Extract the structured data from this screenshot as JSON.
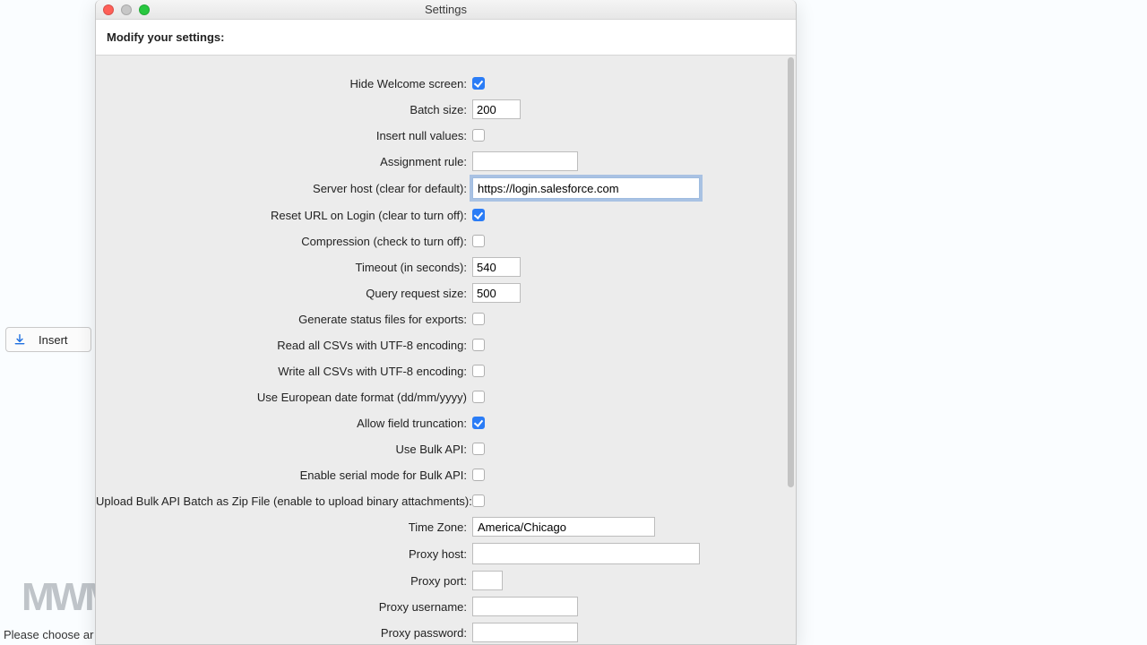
{
  "window": {
    "title": "Settings"
  },
  "header": {
    "title": "Modify your settings:"
  },
  "bg": {
    "insert_label": "Insert",
    "watermark": "MWM",
    "status": "Please choose ar"
  },
  "form": {
    "hide_welcome": {
      "label": "Hide Welcome screen:",
      "checked": true
    },
    "batch_size": {
      "label": "Batch size:",
      "value": "200"
    },
    "insert_nulls": {
      "label": "Insert null values:",
      "checked": false
    },
    "assignment_rule": {
      "label": "Assignment rule:",
      "value": ""
    },
    "server_host": {
      "label": "Server host (clear for default):",
      "value": "https://login.salesforce.com"
    },
    "reset_url": {
      "label": "Reset URL on Login (clear to turn off):",
      "checked": true
    },
    "compression": {
      "label": "Compression (check to turn off):",
      "checked": false
    },
    "timeout": {
      "label": "Timeout (in seconds):",
      "value": "540"
    },
    "query_request_size": {
      "label": "Query request size:",
      "value": "500"
    },
    "gen_status_files": {
      "label": "Generate status files for exports:",
      "checked": false
    },
    "read_utf8": {
      "label": "Read all CSVs with UTF-8 encoding:",
      "checked": false
    },
    "write_utf8": {
      "label": "Write all CSVs with UTF-8 encoding:",
      "checked": false
    },
    "euro_date": {
      "label": "Use European date format (dd/mm/yyyy)",
      "checked": false
    },
    "allow_truncation": {
      "label": "Allow field truncation:",
      "checked": true
    },
    "use_bulk_api": {
      "label": "Use Bulk API:",
      "checked": false
    },
    "serial_bulk": {
      "label": "Enable serial mode for Bulk API:",
      "checked": false
    },
    "bulk_zip": {
      "label": "Upload Bulk API Batch as Zip File (enable to upload binary attachments):",
      "checked": false
    },
    "time_zone": {
      "label": "Time Zone:",
      "value": "America/Chicago"
    },
    "proxy_host": {
      "label": "Proxy host:",
      "value": ""
    },
    "proxy_port": {
      "label": "Proxy port:",
      "value": ""
    },
    "proxy_username": {
      "label": "Proxy username:",
      "value": ""
    },
    "proxy_password": {
      "label": "Proxy password:",
      "value": ""
    }
  }
}
